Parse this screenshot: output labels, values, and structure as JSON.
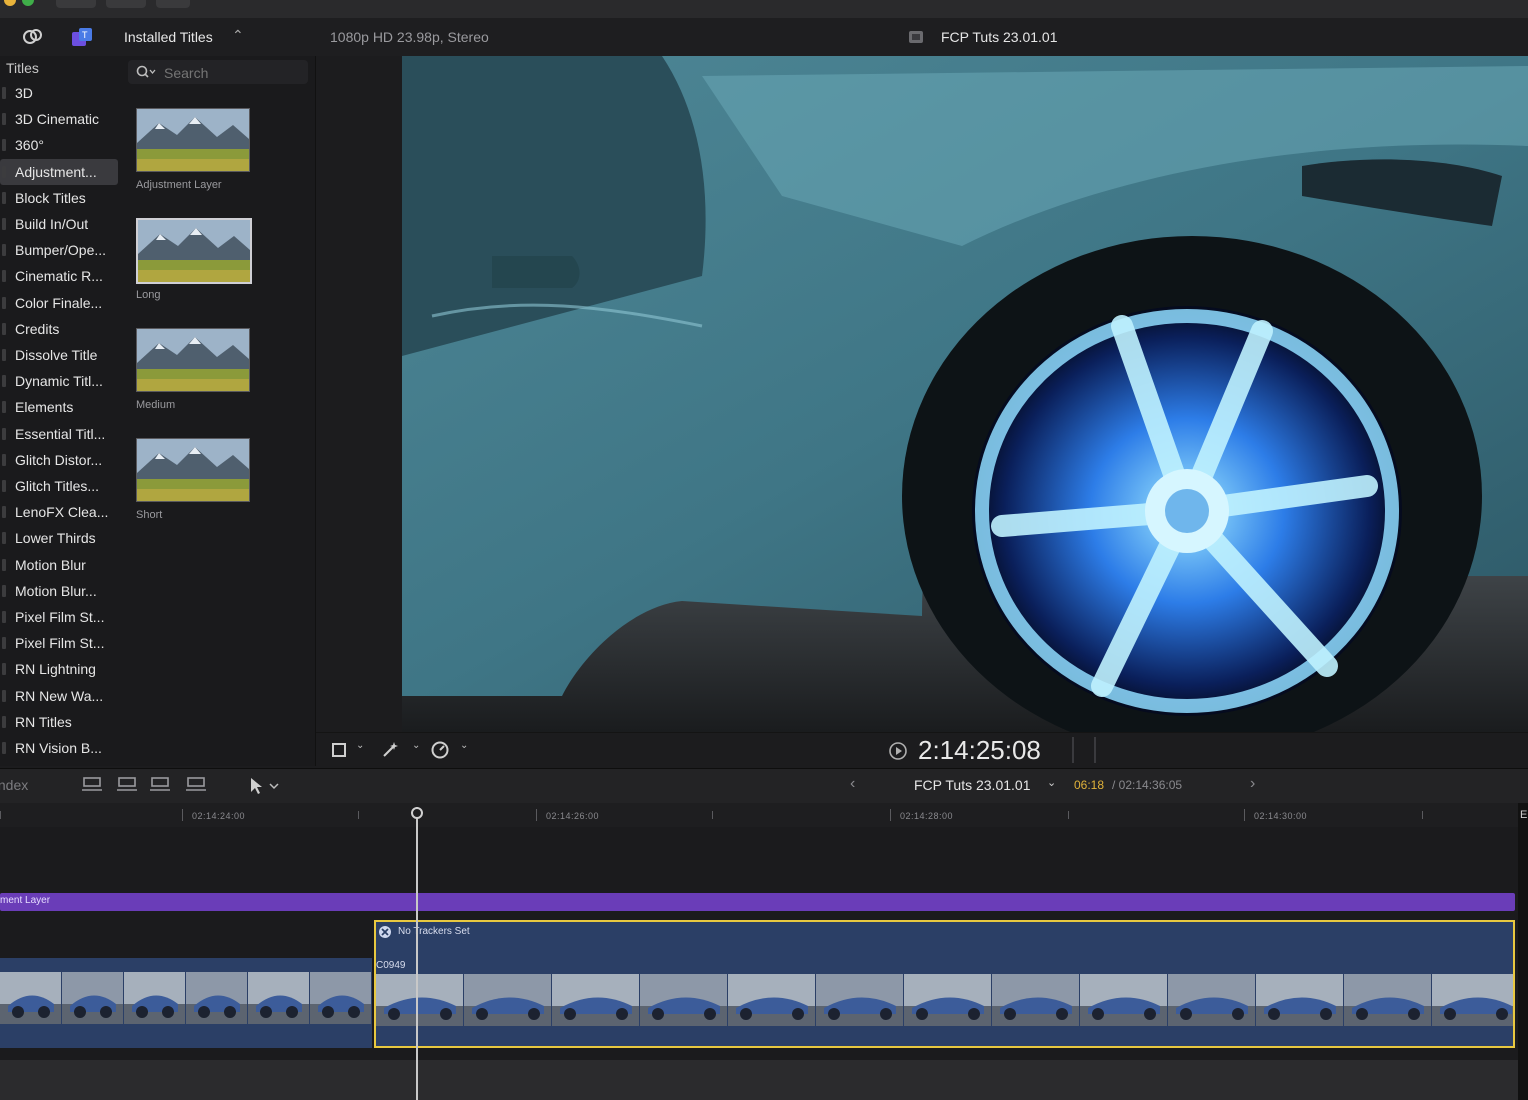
{
  "browser": {
    "dropdown_label": "Installed Titles",
    "dropdown_arrow": "⌃",
    "section_title": "Titles",
    "search_placeholder": "Search",
    "categories": [
      "3D",
      "3D Cinematic",
      "360°",
      "Adjustment...",
      "Block Titles",
      "Build In/Out",
      "Bumper/Ope...",
      "Cinematic R...",
      "Color Finale...",
      "Credits",
      "Dissolve Title",
      "Dynamic Titl...",
      "Elements",
      "Essential Titl...",
      "Glitch Distor...",
      "Glitch Titles...",
      "LenoFX Clea...",
      "Lower Thirds",
      "Motion Blur",
      "Motion Blur...",
      "Pixel Film St...",
      "Pixel Film St...",
      "RN Lightning",
      "RN New Wa...",
      "RN Titles",
      "RN Vision B..."
    ],
    "selected_category": "Adjustment...",
    "thumbnails": [
      "Adjustment Layer",
      "Long",
      "Medium",
      "Short"
    ]
  },
  "viewer": {
    "format_info": "1080p HD 23.98p, Stereo",
    "project_name": "FCP Tuts 23.01.01",
    "timecode": "2:14:25:08"
  },
  "timeline": {
    "index_label": "Index",
    "project_name": "FCP Tuts 23.01.01",
    "current_time": "06:18",
    "total_time": "/ 02:14:36:05",
    "ruler_ticks": [
      "02:14:24:00",
      "02:14:26:00",
      "02:14:28:00",
      "02:14:30:00"
    ],
    "adjustment_layer_label": "ment Layer",
    "clip_tracker_label": "No Trackers Set",
    "clip_name": "C0949",
    "right_edge_letter": "E"
  },
  "icons": [
    "library-icon",
    "photos-icon",
    "search-icon",
    "filmstrip-icon",
    "crop-icon",
    "magic-wand-icon",
    "speed-icon",
    "play-icon",
    "chevron-left-icon",
    "chevron-right-icon",
    "arrow-tool-icon"
  ],
  "colors": {
    "accent_purple": "#6a3db8",
    "selection_yellow": "#e8c840",
    "clip_blue": "#2b3f66",
    "timecode_yellow": "#e0b23a"
  }
}
